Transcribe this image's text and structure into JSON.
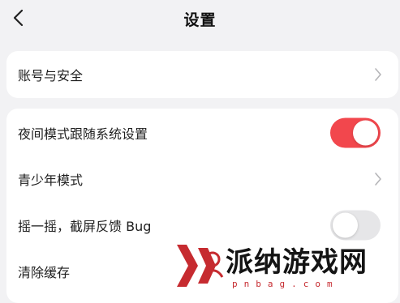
{
  "header": {
    "title": "设置"
  },
  "settings": {
    "account_security": "账号与安全",
    "night_mode": "夜间模式跟随系统设置",
    "teen_mode": "青少年模式",
    "shake_feedback": "摇一摇，截屏反馈 Bug",
    "clear_cache": "清除缓存"
  },
  "toggles": {
    "night_mode_on": true,
    "shake_feedback_on": false
  },
  "watermark": {
    "brand": "派纳游戏网",
    "url": "pnbag.com"
  },
  "colors": {
    "accent": "#f2474d",
    "background": "#f2f2f4",
    "card": "#ffffff",
    "toggle_off": "#e6e6e8"
  },
  "icons": {
    "back": "chevron-left-icon",
    "row_arrow": "chevron-right-icon"
  }
}
